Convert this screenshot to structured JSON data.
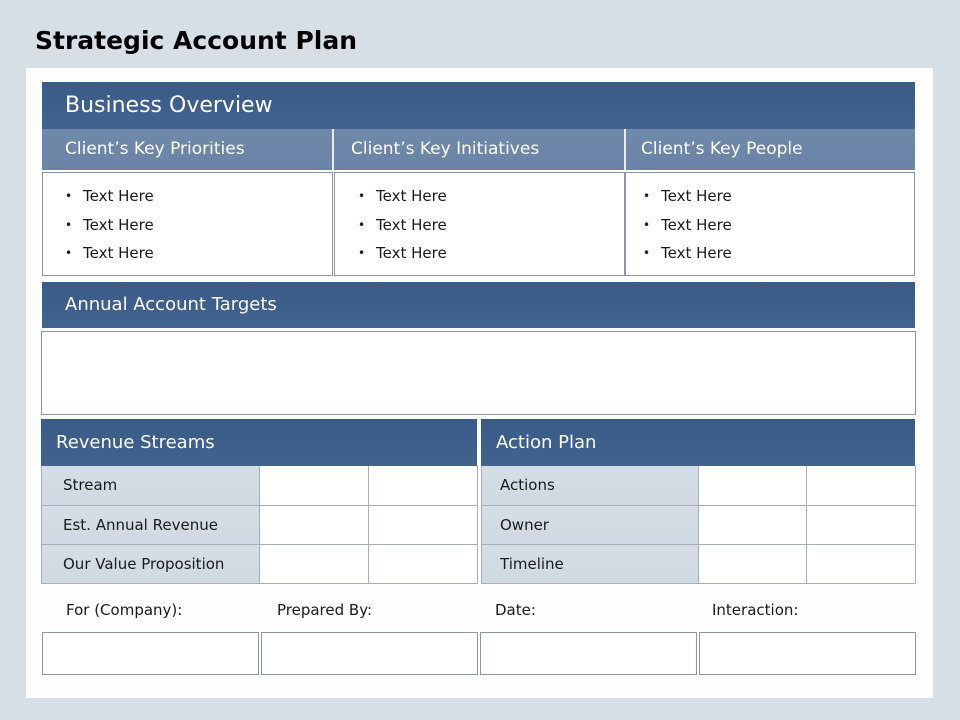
{
  "page": {
    "title": "Strategic Account Plan"
  },
  "business_overview": {
    "title": "Business Overview",
    "columns": [
      {
        "heading": "Client’s Key Priorities",
        "items": [
          "Text Here",
          "Text Here",
          "Text Here"
        ]
      },
      {
        "heading": "Client’s Key Initiatives",
        "items": [
          "Text Here",
          "Text Here",
          "Text Here"
        ]
      },
      {
        "heading": "Client’s Key People",
        "items": [
          "Text Here",
          "Text Here",
          "Text Here"
        ]
      }
    ],
    "bullet": "•"
  },
  "annual_account_targets": {
    "title": "Annual Account Targets",
    "content": ""
  },
  "revenue_streams": {
    "title": "Revenue Streams",
    "rows": [
      "Stream",
      "Est. Annual Revenue",
      "Our Value Proposition"
    ]
  },
  "action_plan": {
    "title": "Action Plan",
    "rows": [
      "Actions",
      "Owner",
      "Timeline"
    ]
  },
  "footer": {
    "fields": [
      {
        "label": "For (Company):",
        "value": ""
      },
      {
        "label": "Prepared By:",
        "value": ""
      },
      {
        "label": "Date:",
        "value": ""
      },
      {
        "label": "Interaction:",
        "value": ""
      }
    ]
  },
  "colors": {
    "header_dark": "#3a5a88",
    "header_mid": "#7089ab",
    "label_cell": "#d5dde6",
    "page_background": "#d6dee6"
  }
}
